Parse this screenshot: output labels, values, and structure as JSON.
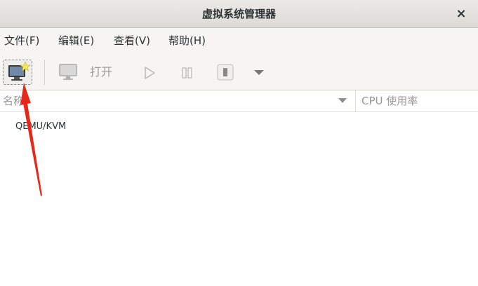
{
  "window": {
    "title": "虚拟系统管理器",
    "close_symbol": "×"
  },
  "menubar": {
    "items": [
      {
        "label": "文件(F)"
      },
      {
        "label": "编辑(E)"
      },
      {
        "label": "查看(V)"
      },
      {
        "label": "帮助(H)"
      }
    ]
  },
  "toolbar": {
    "new_vm_icon": "new-vm-monitor-icon",
    "open_icon": "monitor-icon",
    "open_label": "打开",
    "run_icon": "play-icon",
    "pause_icon": "pause-icon",
    "shutdown_icon": "power-icon",
    "more_icon": "chevron-down-icon"
  },
  "table": {
    "columns": [
      {
        "label": "名称"
      },
      {
        "label": "CPU 使用率"
      }
    ],
    "rows": [
      {
        "label": "QEMU/KVM"
      }
    ]
  },
  "annotation": {
    "arrow_color": "#e8271b"
  },
  "colors": {
    "disabled_text": "#9a9996",
    "menubar_bg": "#f6f5f4"
  }
}
